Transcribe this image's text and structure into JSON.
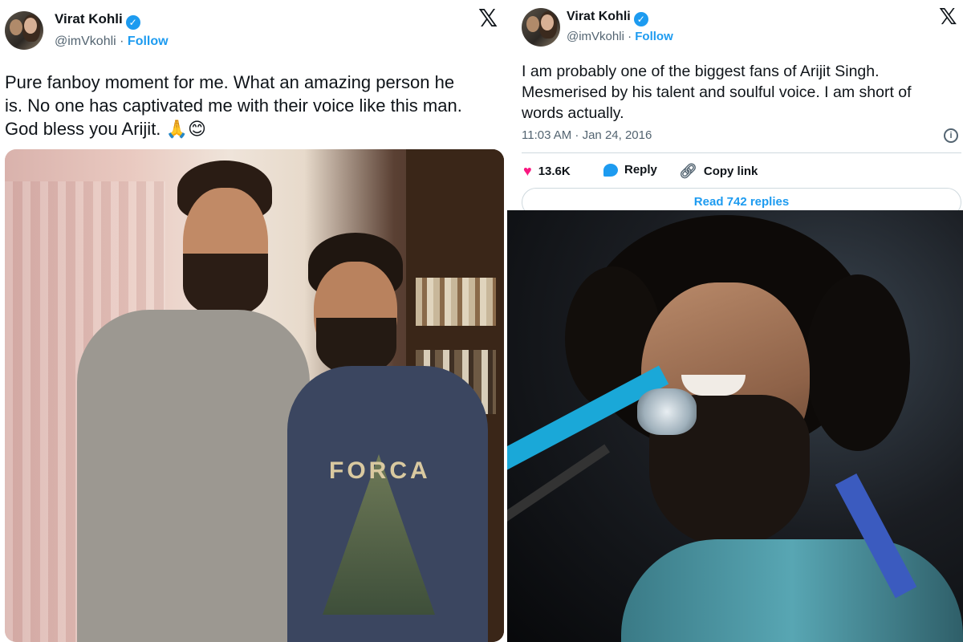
{
  "left_tweet": {
    "author_name": "Virat Kohli",
    "handle": "@imVkohli",
    "separator": " · ",
    "follow_label": "Follow",
    "text_line1": "Pure fanboy moment for me. What an amazing person he",
    "text_line2": "is. No one has captivated me with their voice like this man.",
    "text_line3": "God bless you Arijit.",
    "emojis": "🙏😊",
    "shirt_text": "FORCA",
    "icons": [
      "verified-badge-icon",
      "x-logo-icon"
    ]
  },
  "right_tweet": {
    "author_name": "Virat Kohli",
    "handle": "@imVkohli",
    "separator": " · ",
    "follow_label": "Follow",
    "text_line1": "I am probably one of the biggest fans of Arijit Singh.",
    "text_line2": "Mesmerised by his talent and soulful voice. I am short of",
    "text_line3": "words actually.",
    "timestamp": "11:03 AM · Jan 24, 2016",
    "likes": "13.6K",
    "reply_label": "Reply",
    "copy_link_label": "Copy link",
    "read_replies_label": "Read 742 replies",
    "icons": [
      "verified-badge-icon",
      "x-logo-icon",
      "info-icon",
      "heart-icon",
      "reply-icon",
      "link-icon"
    ]
  },
  "colors": {
    "accent": "#1d9bf0",
    "heart": "#f91880",
    "muted": "#536471",
    "text": "#0f1419"
  }
}
